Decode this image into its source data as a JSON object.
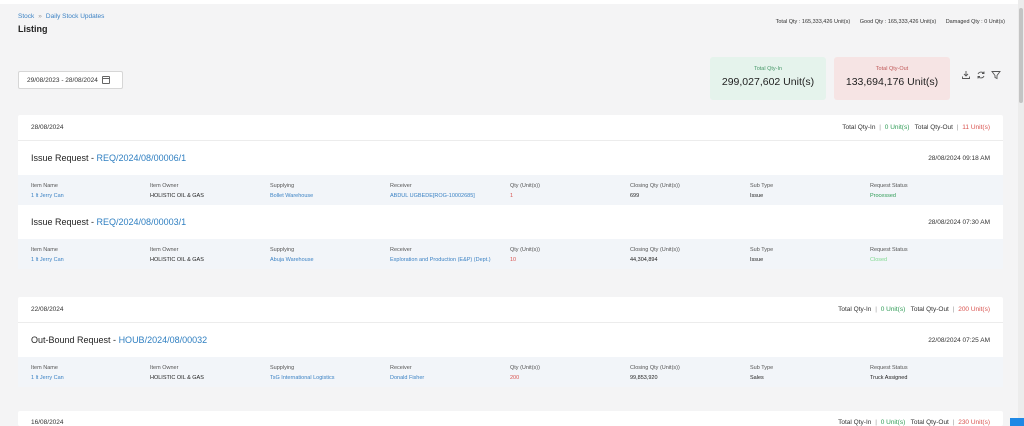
{
  "breadcrumb": {
    "root": "Stock",
    "current": "Daily Stock Updates"
  },
  "page_title": "Listing",
  "totals": {
    "total_qty": "Total Qty : 165,333,426 Unit(s)",
    "good_qty": "Good Qty : 165,333,426 Unit(s)",
    "damaged_qty": "Damaged Qty : 0 Unit(s)"
  },
  "date_range": "29/08/2023 - 28/08/2024",
  "stats": {
    "qty_in_label": "Total Qty-In",
    "qty_in_value": "299,027,602 Unit(s)",
    "qty_out_label": "Total Qty-Out",
    "qty_out_value": "133,694,176 Unit(s)"
  },
  "columns": {
    "item_name": "Item Name",
    "item_owner": "Item Owner",
    "supplying": "Supplying",
    "receiver": "Receiver",
    "qty": "Qty (Unit(s))",
    "closing_qty": "Closing Qty (Unit(s))",
    "sub_type": "Sub Type",
    "request_status": "Request Status"
  },
  "labels": {
    "qty_in": "Total Qty-In",
    "qty_out": "Total Qty-Out",
    "pipe": "|"
  },
  "groups": [
    {
      "date": "28/08/2024",
      "qty_in": "0 Unit(s)",
      "qty_out": "11 Unit(s)",
      "requests": [
        {
          "type": "Issue Request - ",
          "id": "REQ/2024/08/00006/1",
          "time": "28/08/2024 09:18 AM",
          "item_name": "1 lt Jerry Can",
          "item_owner": "HOLISTIC OIL & GAS",
          "supplying": "Bollet Warehouse",
          "receiver": "ABDUL UGBEDE[ROG-10002685]",
          "qty": "1",
          "closing_qty": "699",
          "sub_type": "Issue",
          "status": "Processed"
        },
        {
          "type": "Issue Request - ",
          "id": "REQ/2024/08/00003/1",
          "time": "28/08/2024 07:30 AM",
          "item_name": "1 lt Jerry Can",
          "item_owner": "HOLISTIC OIL & GAS",
          "supplying": "Abuja Warehouse",
          "receiver": "Exploration and Production (E&P) (Dept.)",
          "qty": "10",
          "closing_qty": "44,304,894",
          "sub_type": "Issue",
          "status": "Closed"
        }
      ]
    },
    {
      "date": "22/08/2024",
      "qty_in": "0 Unit(s)",
      "qty_out": "200 Unit(s)",
      "requests": [
        {
          "type": "Out-Bound Request - ",
          "id": "HOUB/2024/08/00032",
          "time": "22/08/2024 07:25 AM",
          "item_name": "1 lt Jerry Can",
          "item_owner": "HOLISTIC OIL & GAS",
          "supplying": "TsG International Logistics",
          "receiver": "Donald Fisher",
          "qty": "200",
          "closing_qty": "99,853,920",
          "sub_type": "Sales",
          "status": "Truck Assigned"
        }
      ]
    },
    {
      "date": "16/08/2024",
      "qty_in": "0 Unit(s)",
      "qty_out": "230 Unit(s)"
    }
  ],
  "colors": {
    "link": "#3b82c4",
    "qty_in_green": "#2e9b55",
    "qty_out_red": "#d9534f"
  },
  "icons": [
    "calendar-icon",
    "export-icon",
    "refresh-icon",
    "filter-icon"
  ]
}
